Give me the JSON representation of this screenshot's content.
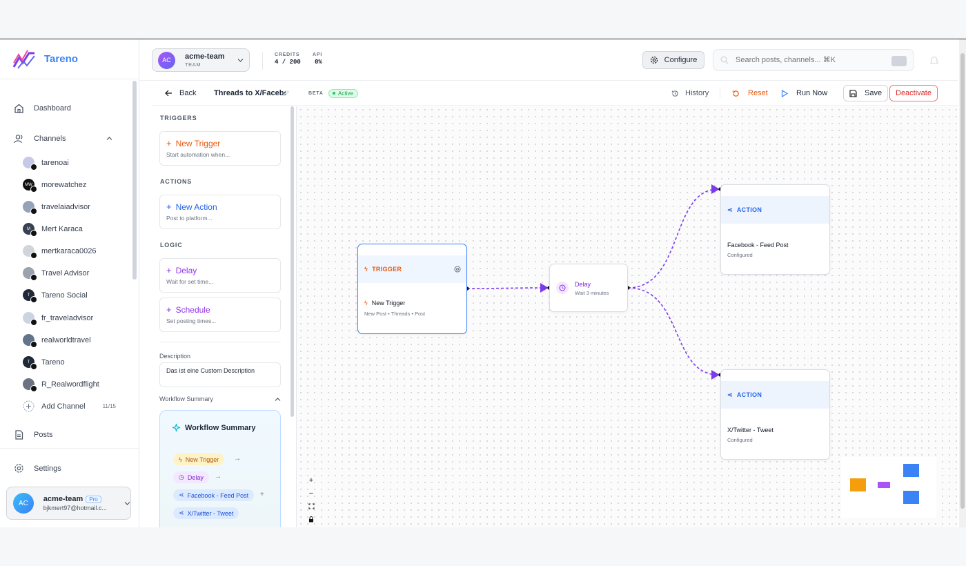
{
  "app": {
    "brand": "Tareno"
  },
  "sidebar": {
    "nav": [
      {
        "label": "Dashboard",
        "icon": "home-icon"
      },
      {
        "label": "Channels",
        "icon": "users-icon"
      },
      {
        "label": "Posts",
        "icon": "file-icon"
      },
      {
        "label": "Settings",
        "icon": "gear-icon"
      }
    ],
    "channels": [
      {
        "name": "tarenoai",
        "platform": "threads"
      },
      {
        "name": "morewatchez",
        "platform": "threads"
      },
      {
        "name": "travelaiadvisor",
        "platform": "threads"
      },
      {
        "name": "Mert Karaca",
        "platform": "linkedin"
      },
      {
        "name": "mertkaraca0026",
        "platform": "threads"
      },
      {
        "name": "Travel Advisor",
        "platform": "threads"
      },
      {
        "name": "Tareno Social",
        "platform": "threads"
      },
      {
        "name": "fr_traveladvisor",
        "platform": "tiktok"
      },
      {
        "name": "realworldtravel",
        "platform": "tiktok"
      },
      {
        "name": "Tareno",
        "platform": "x"
      },
      {
        "name": "R_Realwordflight",
        "platform": "youtube"
      }
    ],
    "add_channel": "Add Channel",
    "channel_count": "11/15",
    "user": {
      "initials": "AC",
      "name": "acme-team",
      "plan": "Pro",
      "email": "bjkmert97@hotmail.c..."
    }
  },
  "topbar": {
    "team": {
      "initials": "AC",
      "name": "acme-team",
      "role": "TEAM"
    },
    "credits_label": "CREDITS",
    "credits_value": "4 / 200",
    "api_label": "API",
    "api_value": "0%",
    "configure": "Configure",
    "search_placeholder": "Search posts, channels... ⌘K"
  },
  "editor": {
    "back": "Back",
    "name": "Threads to X/Facebook",
    "beta": "BETA",
    "status": "Active",
    "history": "History",
    "reset": "Reset",
    "run_now": "Run Now",
    "save": "Save",
    "deactivate": "Deactivate"
  },
  "palette": {
    "triggers_title": "TRIGGERS",
    "actions_title": "ACTIONS",
    "logic_title": "LOGIC",
    "new_trigger": {
      "title": "New Trigger",
      "sub": "Start automation when..."
    },
    "new_action": {
      "title": "New Action",
      "sub": "Post to platform..."
    },
    "delay": {
      "title": "Delay",
      "sub": "Wait for set time..."
    },
    "schedule": {
      "title": "Schedule",
      "sub": "Set posting times..."
    },
    "description_label": "Description",
    "description_value": "Das ist eine Custom Description",
    "summary_label": "Workflow Summary",
    "summary_title": "Workflow Summary",
    "summary_chips": [
      "New Trigger",
      "Delay",
      "Facebook - Feed Post",
      "X/Twitter - Tweet"
    ]
  },
  "canvas": {
    "trigger_node": {
      "tag": "TRIGGER",
      "title": "New Trigger",
      "sub": "New Post • Threads • Post"
    },
    "delay_node": {
      "title": "Delay",
      "sub": "Wait 3 minutes"
    },
    "action_fb": {
      "tag": "ACTION",
      "title": "Facebook - Feed Post",
      "sub": "Configured"
    },
    "action_x": {
      "tag": "ACTION",
      "title": "X/Twitter - Tweet",
      "sub": "Configured"
    }
  },
  "colors": {
    "accent": "#3b82f6",
    "trigger": "#ea580c",
    "logic": "#9333ea",
    "edge": "#7c3aed",
    "danger": "#dc2626"
  }
}
